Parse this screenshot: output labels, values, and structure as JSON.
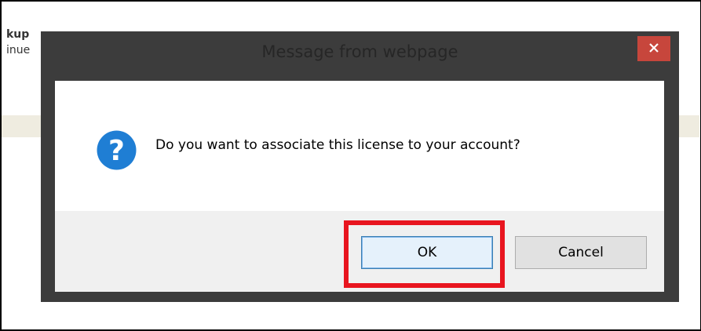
{
  "background": {
    "line1": "kup",
    "line2": "inue"
  },
  "dialog": {
    "title": "Message from webpage",
    "close_icon": "close-icon",
    "question_icon": "question-mark-icon",
    "message": "Do you want to associate this license to your account?",
    "ok_label": "OK",
    "cancel_label": "Cancel",
    "colors": {
      "close_button": "#c7463c",
      "highlight": "#e8151f",
      "question_icon": "#1f7ed4"
    }
  }
}
